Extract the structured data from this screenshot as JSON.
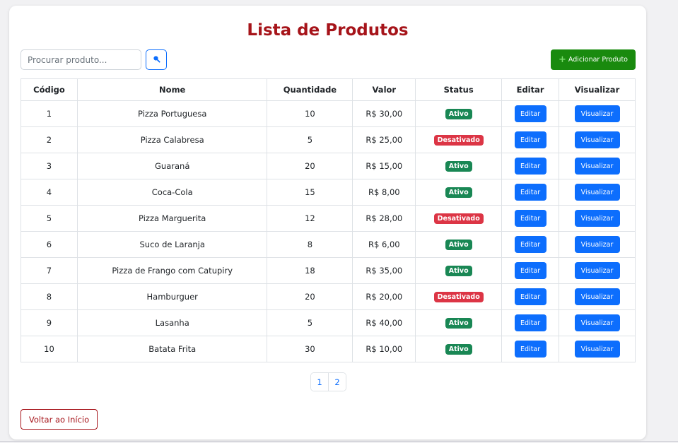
{
  "page": {
    "title": "Lista de Produtos"
  },
  "search": {
    "placeholder": "Procurar produto...",
    "value": ""
  },
  "toolbar": {
    "add_label": "Adicionar Produto",
    "add_icon": "plus-icon",
    "search_icon": "search-icon"
  },
  "table": {
    "columns": [
      "Código",
      "Nome",
      "Quantidade",
      "Valor",
      "Status",
      "Editar",
      "Visualizar"
    ],
    "rows": [
      {
        "code": "1",
        "name": "Pizza Portuguesa",
        "qty": "10",
        "value": "R$ 30,00",
        "status": "Ativo",
        "edit": "Editar",
        "view": "Visualizar"
      },
      {
        "code": "2",
        "name": "Pizza Calabresa",
        "qty": "5",
        "value": "R$ 25,00",
        "status": "Desativado",
        "edit": "Editar",
        "view": "Visualizar"
      },
      {
        "code": "3",
        "name": "Guaraná",
        "qty": "20",
        "value": "R$ 15,00",
        "status": "Ativo",
        "edit": "Editar",
        "view": "Visualizar"
      },
      {
        "code": "4",
        "name": "Coca-Cola",
        "qty": "15",
        "value": "R$ 8,00",
        "status": "Ativo",
        "edit": "Editar",
        "view": "Visualizar"
      },
      {
        "code": "5",
        "name": "Pizza Marguerita",
        "qty": "12",
        "value": "R$ 28,00",
        "status": "Desativado",
        "edit": "Editar",
        "view": "Visualizar"
      },
      {
        "code": "6",
        "name": "Suco de Laranja",
        "qty": "8",
        "value": "R$ 6,00",
        "status": "Ativo",
        "edit": "Editar",
        "view": "Visualizar"
      },
      {
        "code": "7",
        "name": "Pizza de Frango com Catupiry",
        "qty": "18",
        "value": "R$ 35,00",
        "status": "Ativo",
        "edit": "Editar",
        "view": "Visualizar"
      },
      {
        "code": "8",
        "name": "Hamburguer",
        "qty": "20",
        "value": "R$ 20,00",
        "status": "Desativado",
        "edit": "Editar",
        "view": "Visualizar"
      },
      {
        "code": "9",
        "name": "Lasanha",
        "qty": "5",
        "value": "R$ 40,00",
        "status": "Ativo",
        "edit": "Editar",
        "view": "Visualizar"
      },
      {
        "code": "10",
        "name": "Batata Frita",
        "qty": "30",
        "value": "R$ 10,00",
        "status": "Ativo",
        "edit": "Editar",
        "view": "Visualizar"
      }
    ]
  },
  "pagination": {
    "pages": [
      "1",
      "2"
    ]
  },
  "footer": {
    "back_label": "Voltar ao Início"
  },
  "colors": {
    "title": "#a6141a",
    "primary": "#0d6efd",
    "add_button": "#198a0e",
    "status_active": "#198754",
    "status_inactive": "#dc3545"
  }
}
